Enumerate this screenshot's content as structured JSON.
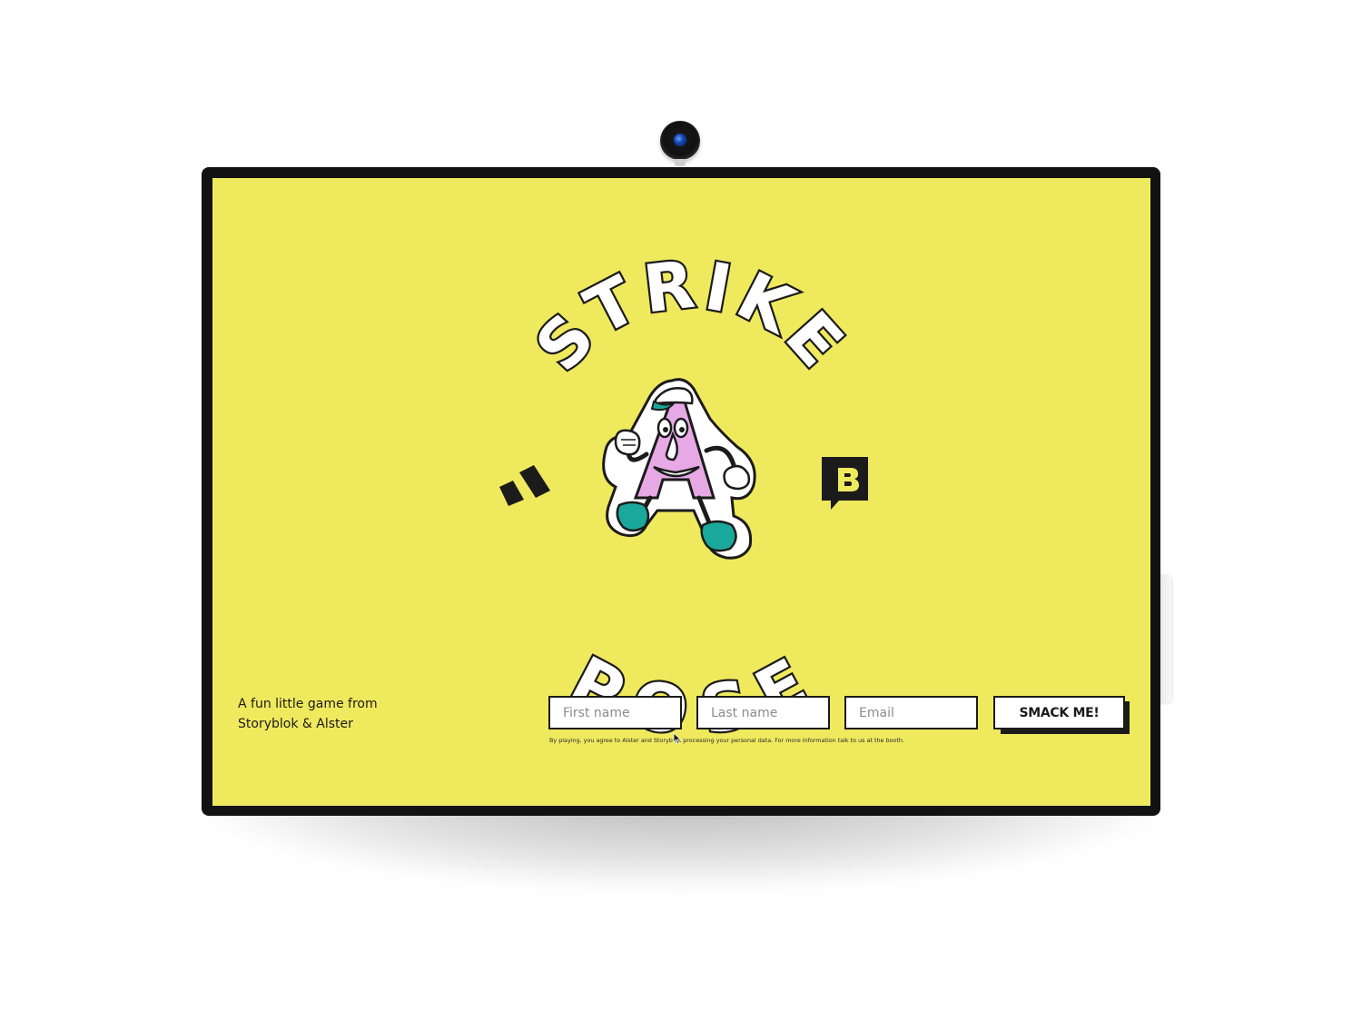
{
  "app": {
    "title_words": [
      "STRIKE",
      "POSE"
    ],
    "colors": {
      "screen_bg": "#efe95e",
      "ink": "#1b1b1b",
      "mascot_pink": "#e7a9e6",
      "mascot_teal": "#1aa89a"
    }
  },
  "logo": {
    "top_word": "STRIKE",
    "bottom_word": "POSE",
    "left_brand_icon": "alster-logo-icon",
    "right_brand_icon": "storyblok-logo-icon",
    "mascot_icon": "letter-a-mascot-icon"
  },
  "intro": {
    "line1": "A fun little game from",
    "line2": "Storyblok & Alster"
  },
  "form": {
    "first_name_placeholder": "First name",
    "last_name_placeholder": "Last name",
    "email_placeholder": "Email",
    "submit_label": "SMACK ME!",
    "consent_text": "By playing, you agree to Alster and Storyblok processing your personal data. For more information talk to us at the booth."
  },
  "device": {
    "camera_icon": "webcam-icon"
  }
}
